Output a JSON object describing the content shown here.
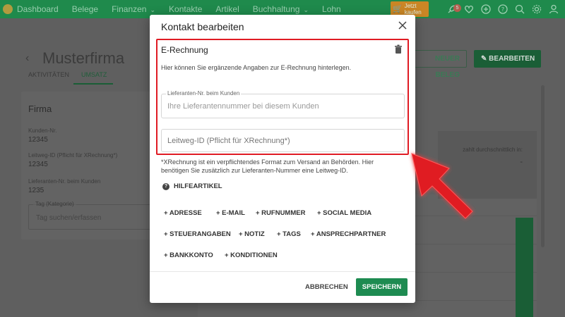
{
  "nav": {
    "items": [
      {
        "label": "Dashboard",
        "dropdown": false
      },
      {
        "label": "Belege",
        "dropdown": false
      },
      {
        "label": "Finanzen",
        "dropdown": true
      },
      {
        "label": "Kontakte",
        "dropdown": false
      },
      {
        "label": "Artikel",
        "dropdown": false
      },
      {
        "label": "Buchhaltung",
        "dropdown": true
      },
      {
        "label": "Lohn",
        "dropdown": false
      }
    ],
    "cta_line1": "Jetzt",
    "cta_line2": "kaufen",
    "notification_count": "5",
    "icons": [
      "rocket-icon",
      "heart-icon",
      "plus-circle-icon",
      "help-icon",
      "search-icon",
      "gear-icon",
      "user-icon"
    ]
  },
  "page": {
    "title": "Musterfirma",
    "tabs": [
      "AKTIVITÄTEN",
      "UMSATZ"
    ],
    "active_tab": "UMSATZ",
    "new_doc_label": "NEUER BELEG",
    "edit_label": "BEARBEITEN",
    "card": {
      "title": "Firma",
      "fields": [
        {
          "label": "Kunden-Nr.",
          "value": "12345"
        },
        {
          "label": "Leitweg-ID (Pflicht für XRechnung*)",
          "value": "12345"
        },
        {
          "label": "Lieferanten-Nr. beim Kunden",
          "value": "1235"
        }
      ],
      "tag_legend": "Tag (Kategorie)",
      "tag_placeholder": "Tag suchen/erfassen"
    },
    "right_panel": {
      "label": "zahlt durchschnittlich in:",
      "value": "-"
    }
  },
  "modal": {
    "title": "Kontakt bearbeiten",
    "section_title": "E-Rechnung",
    "section_desc": "Hier können Sie ergänzende Angaben zur E-Rechnung hinterlegen.",
    "supplier_field": {
      "label": "Lieferanten-Nr. beim Kunden",
      "placeholder": "Ihre Lieferantennummer bei diesem Kunden"
    },
    "leitweg_field": {
      "placeholder": "Leitweg-ID (Pflicht für XRechnung*)"
    },
    "note": "*XRechnung ist ein verpflichtendes Format zum Versand an Behörden. Hier benötigen Sie zusätzlich zur Lieferanten-Nummer eine Leitweg-ID.",
    "help_label": "HILFEARTIKEL",
    "chips": [
      "+ ADRESSE",
      "+ E-MAIL",
      "+ RUFNUMMER",
      "+ SOCIAL MEDIA",
      "+ STEUERANGABEN",
      "+ NOTIZ",
      "+ TAGS",
      "+ ANSPRECHPARTNER",
      "+ BANKKONTO",
      "+ KONDITIONEN"
    ],
    "cancel_label": "ABBRECHEN",
    "save_label": "SPEICHERN"
  },
  "colors": {
    "brand_green": "#1f8a4c",
    "save_green": "#1e8b51",
    "highlight_red": "#e01b24",
    "cta_orange": "#e8861f"
  }
}
